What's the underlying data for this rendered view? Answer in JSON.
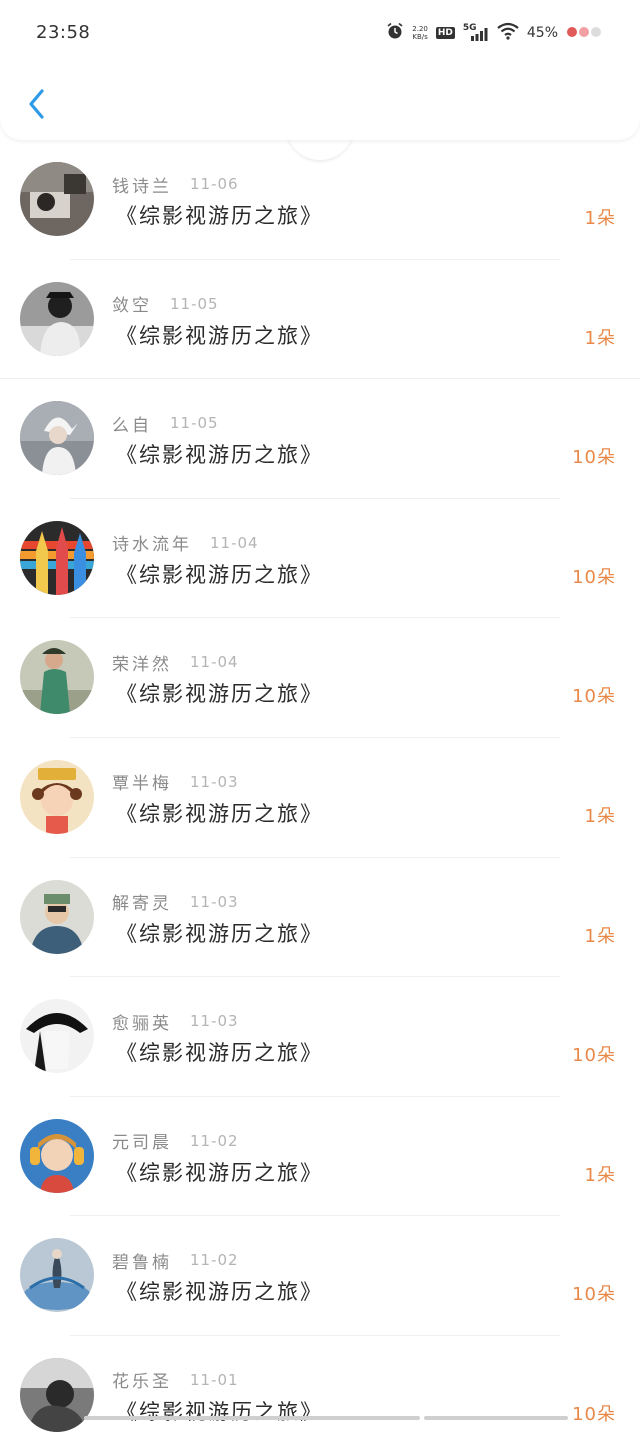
{
  "status_bar": {
    "time": "23:58",
    "network_speed_value": "2.20",
    "network_speed_unit": "KB/s",
    "hd": "HD",
    "signal": "5G",
    "battery": "45%"
  },
  "nav": {
    "back_icon": "chevron-left-icon",
    "accent": "#2e9be8"
  },
  "records": [
    {
      "name": "钱诗兰",
      "date": "11-06",
      "title": "《综影视游历之旅》",
      "amount": "1朵"
    },
    {
      "name": "敛空",
      "date": "11-05",
      "title": "《综影视游历之旅》",
      "amount": "1朵"
    },
    {
      "name": "么自",
      "date": "11-05",
      "title": "《综影视游历之旅》",
      "amount": "10朵"
    },
    {
      "name": "诗水流年",
      "date": "11-04",
      "title": "《综影视游历之旅》",
      "amount": "10朵"
    },
    {
      "name": "荣洋然",
      "date": "11-04",
      "title": "《综影视游历之旅》",
      "amount": "10朵"
    },
    {
      "name": "覃半梅",
      "date": "11-03",
      "title": "《综影视游历之旅》",
      "amount": "1朵"
    },
    {
      "name": "解寄灵",
      "date": "11-03",
      "title": "《综影视游历之旅》",
      "amount": "1朵"
    },
    {
      "name": "愈骊英",
      "date": "11-03",
      "title": "《综影视游历之旅》",
      "amount": "10朵"
    },
    {
      "name": "元司晨",
      "date": "11-02",
      "title": "《综影视游历之旅》",
      "amount": "1朵"
    },
    {
      "name": "碧鲁楠",
      "date": "11-02",
      "title": "《综影视游历之旅》",
      "amount": "10朵"
    },
    {
      "name": "花乐圣",
      "date": "11-01",
      "title": "《综影视游历之旅》",
      "amount": "10朵"
    }
  ],
  "colors": {
    "amount": "#e8894a",
    "name": "#8a8a8a",
    "date": "#b4b4b4"
  }
}
